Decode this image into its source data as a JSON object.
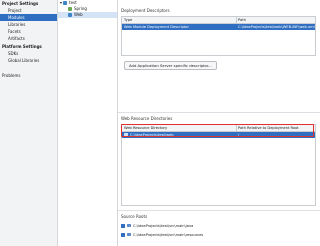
{
  "sidebar": {
    "project_settings_heading": "Project Settings",
    "project_items": [
      {
        "label": "Project"
      },
      {
        "label": "Modules"
      },
      {
        "label": "Libraries"
      },
      {
        "label": "Facets"
      },
      {
        "label": "Artifacts"
      }
    ],
    "platform_settings_heading": "Platform Settings",
    "platform_items": [
      {
        "label": "SDKs"
      },
      {
        "label": "Global Libraries"
      }
    ],
    "problems_label": "Problems",
    "active_item": "Modules"
  },
  "tree": {
    "nodes": [
      {
        "label": "test"
      },
      {
        "label": "Spring"
      },
      {
        "label": "Web"
      }
    ],
    "selected": "Web"
  },
  "main": {
    "deployment_descriptors": {
      "heading": "Deployment Descriptors",
      "columns": [
        "Type",
        "Path"
      ],
      "rows": [
        {
          "type": "Web Module Deployment Descriptor",
          "path": "C:\\ideaProjects\\test\\web\\WEB-INF\\web.xml"
        }
      ],
      "add_button": "Add Application Server specific descriptor..."
    },
    "web_resource_directories": {
      "heading": "Web Resource Directories",
      "columns": [
        "Web Resource Directory",
        "Path Relative to Deployment Root"
      ],
      "rows": [
        {
          "directory": "C:\\ideaProjects\\test\\web",
          "path": "/"
        }
      ]
    },
    "source_roots": {
      "heading": "Source Roots",
      "items": [
        {
          "path": "C:\\ideaProjects\\test\\src\\main\\java",
          "checked": true
        },
        {
          "path": "C:\\ideaProjects\\test\\src\\main\\resources",
          "checked": true
        }
      ]
    }
  },
  "colors": {
    "accent": "#2f6ec0",
    "highlight_frame": "#e0322a",
    "sidebar_bg": "#f2f3f5"
  }
}
